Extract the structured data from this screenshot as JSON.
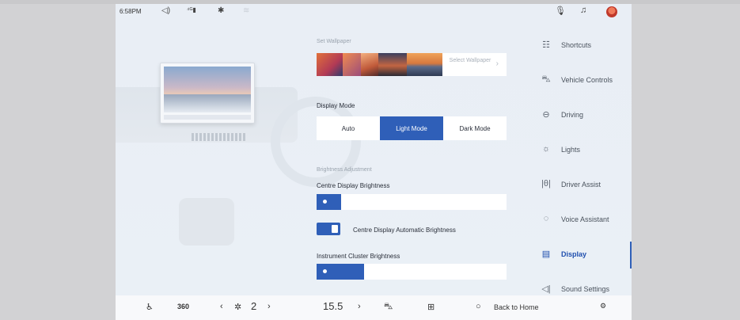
{
  "status_bar": {
    "time": "6:58PM",
    "icons": [
      "volume-icon",
      "signal-icon",
      "bluetooth-icon",
      "wifi-icon",
      "microphone-icon",
      "bell-icon",
      "avatar"
    ]
  },
  "wallpaper": {
    "section_label": "Set Wallpaper",
    "select_label": "Select Wallpaper",
    "thumbnails": 5
  },
  "display_mode": {
    "label": "Display Mode",
    "options": [
      "Auto",
      "Light Mode",
      "Dark Mode"
    ],
    "selected": "Light Mode"
  },
  "brightness": {
    "section_label": "Brightness Adjustment",
    "centre_label": "Centre Display Brightness",
    "centre_level": 0.13,
    "auto_label": "Centre Display Automatic Brightness",
    "auto_enabled": true,
    "cluster_label": "Instrument Cluster Brightness",
    "cluster_level": 0.25
  },
  "menu": {
    "items": [
      {
        "label": "Shortcuts",
        "icon": "shortcuts-icon"
      },
      {
        "label": "Vehicle Controls",
        "icon": "car-icon"
      },
      {
        "label": "Driving",
        "icon": "steering-wheel-icon"
      },
      {
        "label": "Lights",
        "icon": "light-bulb-icon"
      },
      {
        "label": "Driver Assist",
        "icon": "driver-assist-icon"
      },
      {
        "label": "Voice Assistant",
        "icon": "voice-assistant-icon"
      },
      {
        "label": "Display",
        "icon": "display-icon"
      },
      {
        "label": "Sound Settings",
        "icon": "speaker-icon"
      }
    ],
    "active": "Display"
  },
  "bottom_bar": {
    "view_360": "360",
    "fan_level": "2",
    "temperature": "15.5",
    "back_home": "Back to Home"
  },
  "colors": {
    "accent": "#2f5fb8",
    "background": "#e9eef5"
  }
}
